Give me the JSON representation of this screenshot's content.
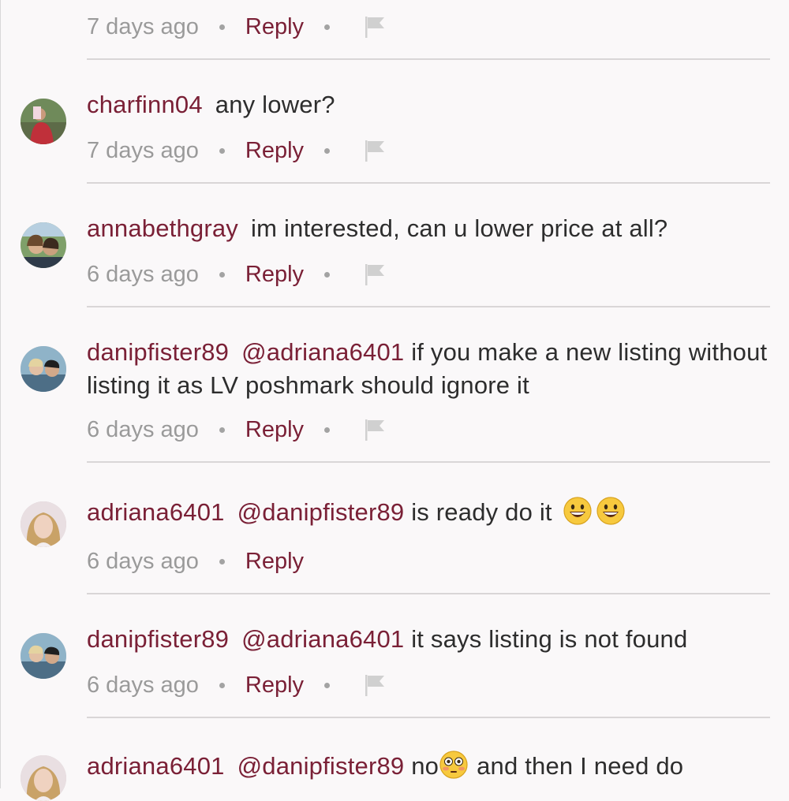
{
  "colors": {
    "accent": "#7a2036",
    "muted": "#9a9a9a",
    "background": "#faf8f9",
    "divider": "#d9d6d7"
  },
  "top_meta": {
    "time": "7 days ago",
    "reply_label": "Reply",
    "flag_icon": "flag-icon"
  },
  "comments": [
    {
      "username": "charfinn04",
      "mention": "",
      "text": "any lower?",
      "time": "7 days ago",
      "reply_label": "Reply",
      "has_flag": true
    },
    {
      "username": "annabethgray",
      "mention": "",
      "text": "im interested, can u lower price at all?",
      "time": "6 days ago",
      "reply_label": "Reply",
      "has_flag": true
    },
    {
      "username": "danipfister89",
      "mention": "@adriana6401",
      "text": "if you make a new listing without listing it as LV poshmark should ignore it",
      "time": "6 days ago",
      "reply_label": "Reply",
      "has_flag": true
    },
    {
      "username": "adriana6401",
      "mention": "@danipfister89",
      "text": "is ready do it",
      "emoji": [
        "grinning-face-emoji",
        "grinning-face-emoji"
      ],
      "time": "6 days ago",
      "reply_label": "Reply",
      "has_flag": false
    },
    {
      "username": "danipfister89",
      "mention": "@adriana6401",
      "text": "it says listing is not found",
      "time": "6 days ago",
      "reply_label": "Reply",
      "has_flag": true
    },
    {
      "username": "adriana6401",
      "mention": "@danipfister89",
      "text_before_emoji": "no",
      "emoji": [
        "flushed-face-emoji"
      ],
      "text": "and then I need do"
    }
  ]
}
